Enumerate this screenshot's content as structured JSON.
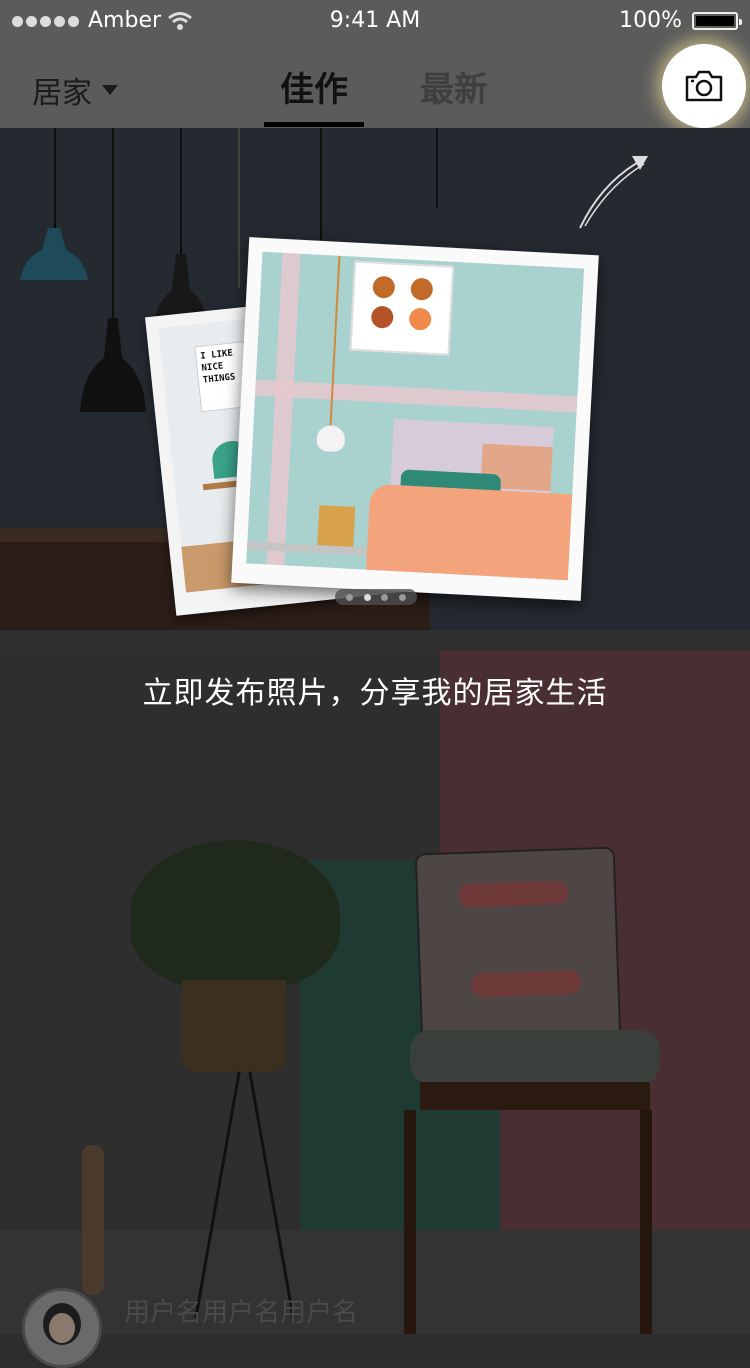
{
  "status_bar": {
    "carrier": "Amber",
    "time": "9:41 AM",
    "battery": "100%"
  },
  "nav": {
    "category": "居家",
    "tabs": [
      {
        "label": "佳作",
        "active": true
      },
      {
        "label": "最新",
        "active": false
      }
    ],
    "camera_icon": "camera-icon"
  },
  "banner": {
    "photo_back_text": "I LIKE NICE THINGS",
    "pager": {
      "count": 4,
      "active": 1
    }
  },
  "prompt": "立即发布照片，分享我的居家生活",
  "feed_item": {
    "username": "用户名用户名用户名"
  },
  "colors": {
    "overlay_bar": "#5b5b5b",
    "camera_glow": "#ffeca0",
    "accent_tab": "#000000"
  }
}
